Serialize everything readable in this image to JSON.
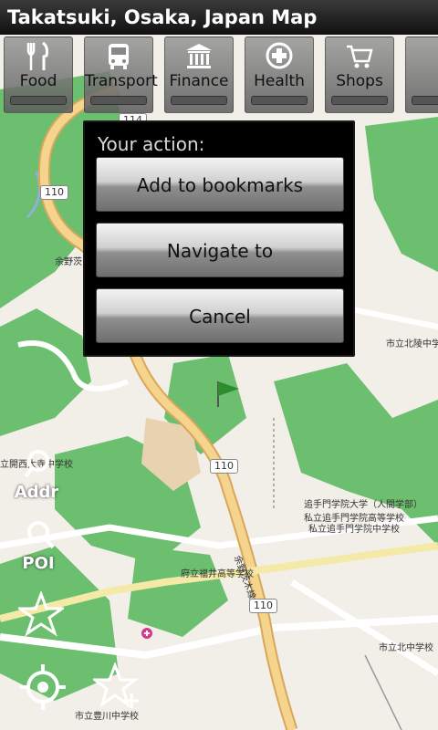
{
  "app": {
    "title": "Takatsuki, Osaka, Japan Map"
  },
  "categories": [
    {
      "label": "Food",
      "icon": "fork-knife-icon"
    },
    {
      "label": "Transport",
      "icon": "bus-icon"
    },
    {
      "label": "Finance",
      "icon": "bank-icon"
    },
    {
      "label": "Health",
      "icon": "medical-cross-icon"
    },
    {
      "label": "Shops",
      "icon": "shopping-cart-icon"
    }
  ],
  "dialog": {
    "title": "Your action:",
    "buttons": [
      "Add to bookmarks",
      "Navigate to",
      "Cancel"
    ]
  },
  "tools": {
    "addr": "Addr",
    "poi": "POI"
  },
  "map_labels": {
    "road_110": "110",
    "road_114": "114",
    "school_1": "立開西大寺中学校",
    "school_2": "市立北陵中学校",
    "school_3": "追手門学院大学（人間学部）",
    "school_4": "私立追手門学院高等学校",
    "school_5": "私立追手門学院中学校",
    "school_6": "府立福井高等学校",
    "school_7": "市立北中学校",
    "school_8": "市立豊川中学校",
    "road_name_1": "余野茨木線",
    "road_name_2": "余野茨"
  },
  "colors": {
    "forest": "#6bbf6e",
    "road_major": "#f5d48d",
    "road_minor": "#ffffff",
    "dialog_bg": "#000000"
  }
}
